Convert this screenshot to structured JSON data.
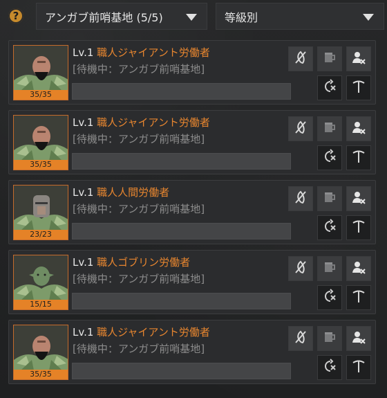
{
  "header": {
    "help_label": "?",
    "base_select": "アンガブ前哨基地 (5/5)",
    "sort_select": "等級別"
  },
  "workers": [
    {
      "level": "Lv.1",
      "name": "職人ジャイアント労働者",
      "status": "[待機中：アンガブ前哨基地]",
      "stamina": "35/35",
      "race": "giant"
    },
    {
      "level": "Lv.1",
      "name": "職人ジャイアント労働者",
      "status": "[待機中：アンガブ前哨基地]",
      "stamina": "35/35",
      "race": "giant"
    },
    {
      "level": "Lv.1",
      "name": "職人人間労働者",
      "status": "[待機中：アンガブ前哨基地]",
      "stamina": "23/23",
      "race": "human"
    },
    {
      "level": "Lv.1",
      "name": "職人ゴブリン労働者",
      "status": "[待機中：アンガブ前哨基地]",
      "stamina": "15/15",
      "race": "goblin"
    },
    {
      "level": "Lv.1",
      "name": "職人ジャイアント労働者",
      "status": "[待機中：アンガブ前哨基地]",
      "stamina": "35/35",
      "race": "giant"
    }
  ],
  "colors": {
    "accent_orange": "#e8862f",
    "stamina_bar": "#e58227",
    "help_button": "#c68a2c"
  },
  "icons": [
    "help-icon",
    "chevron-down-icon",
    "no-food-icon",
    "beer-mug-icon",
    "fire-worker-icon",
    "repeat-icon",
    "pickaxe-icon"
  ]
}
